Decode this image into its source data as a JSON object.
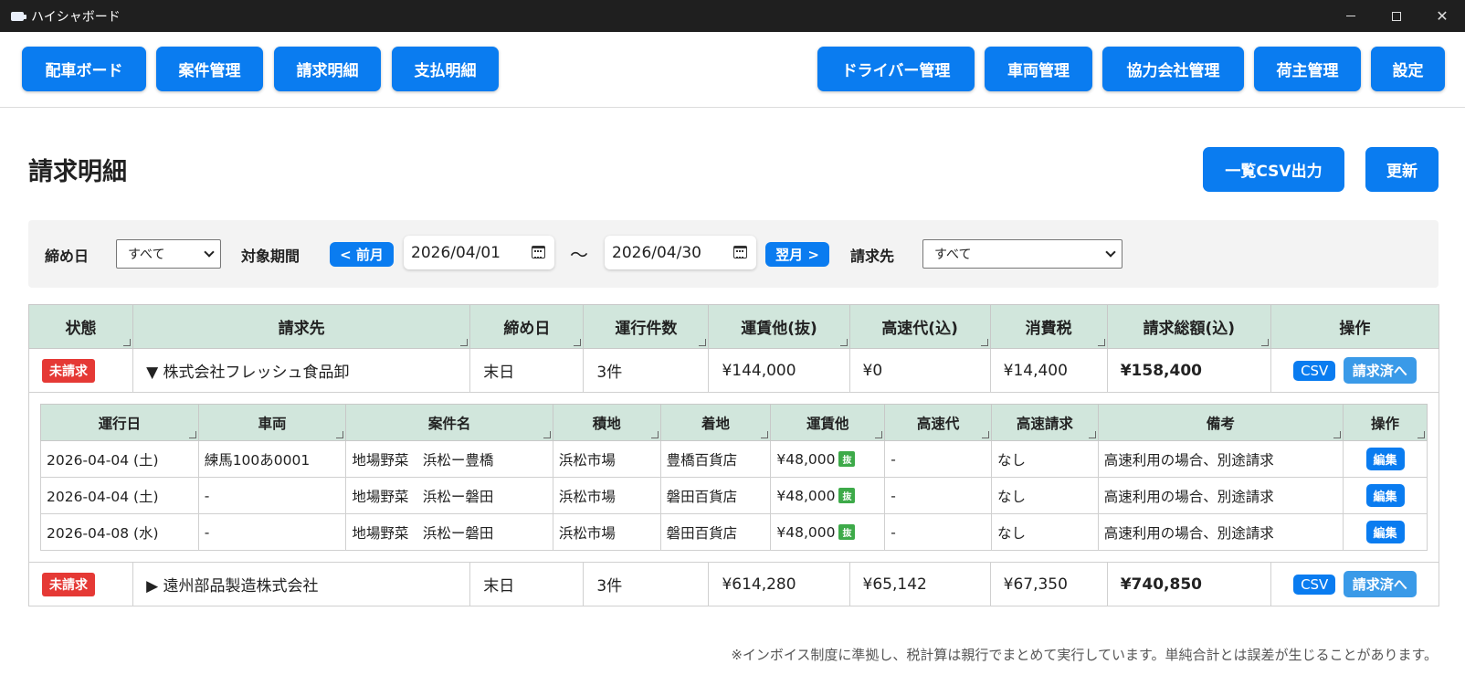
{
  "window": {
    "title": "ハイシャボード"
  },
  "nav": {
    "left": [
      "配車ボード",
      "案件管理",
      "請求明細",
      "支払明細"
    ],
    "right": [
      "ドライバー管理",
      "車両管理",
      "協力会社管理",
      "荷主管理",
      "設定"
    ]
  },
  "page": {
    "title": "請求明細",
    "csv_export": "一覧CSV出力",
    "refresh": "更新"
  },
  "filter": {
    "closing_label": "締め日",
    "closing_value": "すべて",
    "period_label": "対象期間",
    "prev_month": "< 前月",
    "start_date": "2026/04/01",
    "tilde": "〜",
    "end_date": "2026/04/30",
    "next_month": "翌月 >",
    "billto_label": "請求先",
    "billto_value": "すべて"
  },
  "table": {
    "headers": [
      "状態",
      "請求先",
      "締め日",
      "運行件数",
      "運賃他(抜)",
      "高速代(込)",
      "消費税",
      "請求総額(込)",
      "操作"
    ],
    "rows": [
      {
        "status": "未請求",
        "client": "▼ 株式会社フレッシュ食品卸",
        "closing": "末日",
        "count": "3件",
        "fare": "¥144,000",
        "highway": "¥0",
        "tax": "¥14,400",
        "total": "¥158,400",
        "csv": "CSV",
        "done": "請求済へ"
      },
      {
        "status": "未請求",
        "client": "▶ 遠州部品製造株式会社",
        "closing": "末日",
        "count": "3件",
        "fare": "¥614,280",
        "highway": "¥65,142",
        "tax": "¥67,350",
        "total": "¥740,850",
        "csv": "CSV",
        "done": "請求済へ"
      }
    ]
  },
  "detail": {
    "headers": [
      "運行日",
      "車両",
      "案件名",
      "積地",
      "着地",
      "運賃他",
      "高速代",
      "高速請求",
      "備考",
      "操作"
    ],
    "rows": [
      {
        "date": "2026-04-04 (土)",
        "vehicle": "練馬100あ0001",
        "job": "地場野菜　浜松ー豊橋",
        "load": "浜松市場",
        "unload": "豊橋百貨店",
        "fare": "¥48,000",
        "badge": "抜",
        "highway": "-",
        "hw_bill": "なし",
        "note": "高速利用の場合、別途請求",
        "edit": "編集"
      },
      {
        "date": "2026-04-04 (土)",
        "vehicle": "-",
        "job": "地場野菜　浜松ー磐田",
        "load": "浜松市場",
        "unload": "磐田百貨店",
        "fare": "¥48,000",
        "badge": "抜",
        "highway": "-",
        "hw_bill": "なし",
        "note": "高速利用の場合、別途請求",
        "edit": "編集"
      },
      {
        "date": "2026-04-08 (水)",
        "vehicle": "-",
        "job": "地場野菜　浜松ー磐田",
        "load": "浜松市場",
        "unload": "磐田百貨店",
        "fare": "¥48,000",
        "badge": "抜",
        "highway": "-",
        "hw_bill": "なし",
        "note": "高速利用の場合、別途請求",
        "edit": "編集"
      }
    ]
  },
  "footnote": "※インボイス制度に準拠し、税計算は親行でまとめて実行しています。単純合計とは誤差が生じることがあります。"
}
